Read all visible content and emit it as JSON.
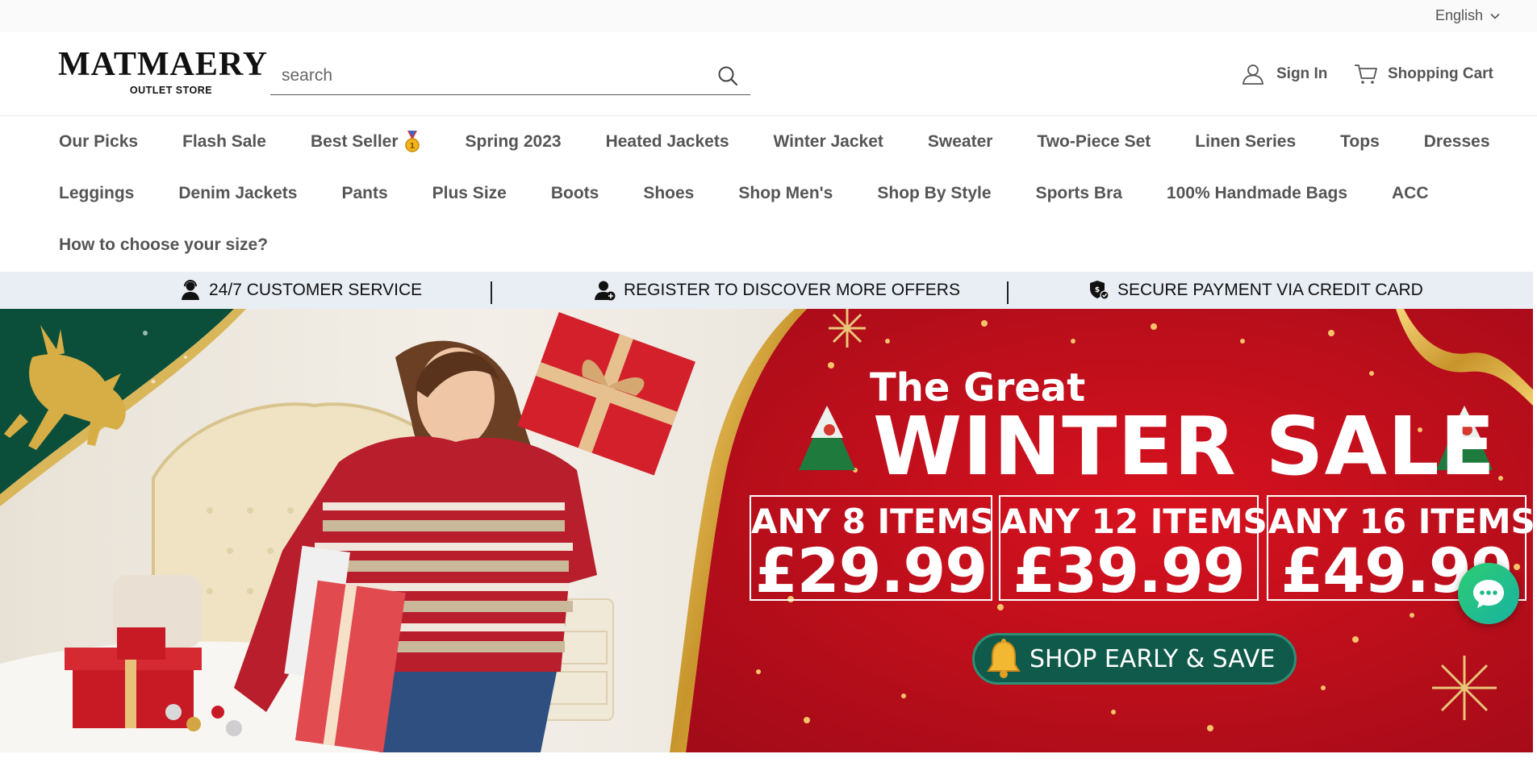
{
  "topbar": {
    "language": "English"
  },
  "header": {
    "logo_main": "MATMAERY",
    "logo_sub": "OUTLET STORE",
    "search_placeholder": "search",
    "account_label": "Sign In",
    "cart_label": "Shopping Cart"
  },
  "nav": {
    "row1": [
      "Our Picks",
      "Flash Sale",
      "Best Seller",
      "Spring 2023",
      "Heated Jackets",
      "Winter Jacket",
      "Sweater",
      "Two-Piece Set",
      "Linen Series",
      "Tops",
      "Dresses"
    ],
    "row2": [
      "Leggings",
      "Denim Jackets",
      "Pants",
      "Plus Size",
      "Boots",
      "Shoes",
      "Shop Men's",
      "Shop By Style",
      "Sports Bra",
      "100% Handmade Bags",
      "ACC"
    ],
    "row3": [
      "How to choose your size?"
    ]
  },
  "benefits": {
    "service": "24/7 CUSTOMER SERVICE",
    "register": "REGISTER TO DISCOVER MORE OFFERS",
    "payment": "SECURE PAYMENT VIA CREDIT CARD"
  },
  "hero": {
    "subtitle": "The Great",
    "title": "WINTER SALE",
    "offers": [
      {
        "label": "ANY 8 ITEMS",
        "price": "£29.99"
      },
      {
        "label": "ANY 12 ITEMS",
        "price": "£39.99"
      },
      {
        "label": "ANY 16 ITEMS",
        "price": "£49.99"
      }
    ],
    "cta": "SHOP EARLY & SAVE"
  },
  "colors": {
    "hero_red": "#c8101f",
    "hero_green": "#0b4f3b",
    "nav_text": "#555555",
    "benefits_bg": "#e9edf4",
    "chat_green": "#2ecc71"
  },
  "icons": {
    "language": "chevron-down-icon",
    "search": "search-icon",
    "account": "user-icon",
    "cart": "cart-icon",
    "best_seller": "medal-icon",
    "service": "support-agent-icon",
    "register": "user-add-icon",
    "payment": "shield-check-icon",
    "cta": "bell-icon",
    "chat": "chat-bubble-icon"
  }
}
